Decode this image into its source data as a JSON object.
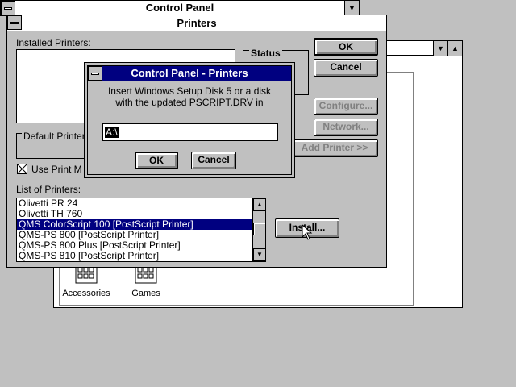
{
  "control_panel": {
    "title": "Control Panel",
    "icons": [
      {
        "label": "Accessories",
        "icon": "program-group-icon"
      },
      {
        "label": "Games",
        "icon": "program-group-icon"
      }
    ]
  },
  "printers": {
    "title": "Printers",
    "installed_label": "Installed Printers:",
    "status_label": "Status",
    "default_label": "Default Printer",
    "use_print_manager_label": "Use Print M",
    "use_print_manager_checked": true,
    "list_label": "List of Printers:",
    "printers_list": [
      {
        "name": "Olivetti PR 24",
        "selected": false
      },
      {
        "name": "Olivetti TH 760",
        "selected": false
      },
      {
        "name": "QMS ColorScript 100 [PostScript Printer]",
        "selected": true
      },
      {
        "name": "QMS-PS 800 [PostScript Printer]",
        "selected": false
      },
      {
        "name": "QMS-PS 800 Plus [PostScript Printer]",
        "selected": false
      },
      {
        "name": "QMS-PS 810 [PostScript Printer]",
        "selected": false
      }
    ],
    "buttons": {
      "ok": "OK",
      "cancel": "Cancel",
      "configure": "Configure...",
      "network": "Network...",
      "add_printer": "Add Printer >>",
      "install": "Install..."
    }
  },
  "dialog": {
    "title": "Control Panel - Printers",
    "message_line1": "Insert Windows Setup Disk 5 or a disk",
    "message_line2": "with the updated PSCRIPT.DRV in",
    "path_value": "A:\\",
    "ok": "OK",
    "cancel": "Cancel"
  },
  "colors": {
    "title_active": "#000080",
    "desktop": "#c0c0c0"
  }
}
